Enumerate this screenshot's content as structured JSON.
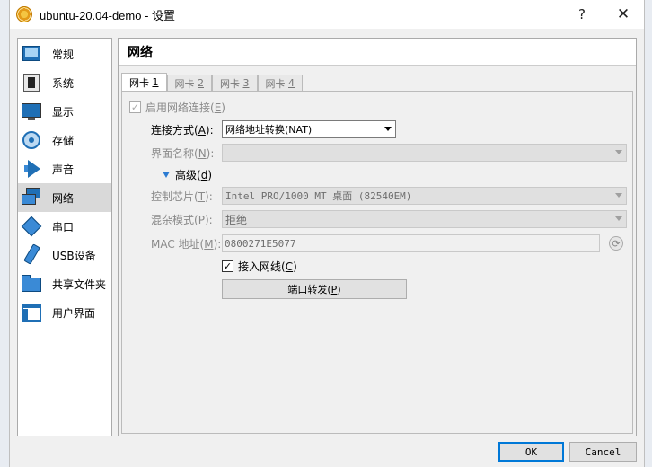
{
  "window": {
    "title": "ubuntu-20.04-demo - 设置",
    "help": "?",
    "close": "✕"
  },
  "sidebar": {
    "items": [
      {
        "label": "常规",
        "icon": "general-icon"
      },
      {
        "label": "系统",
        "icon": "system-icon"
      },
      {
        "label": "显示",
        "icon": "display-icon"
      },
      {
        "label": "存储",
        "icon": "storage-icon"
      },
      {
        "label": "声音",
        "icon": "audio-icon"
      },
      {
        "label": "网络",
        "icon": "network-icon",
        "selected": true
      },
      {
        "label": "串口",
        "icon": "serial-port-icon"
      },
      {
        "label": "USB设备",
        "icon": "usb-icon"
      },
      {
        "label": "共享文件夹",
        "icon": "shared-folder-icon"
      },
      {
        "label": "用户界面",
        "icon": "user-interface-icon"
      }
    ]
  },
  "page": {
    "title": "网络"
  },
  "tabs": [
    {
      "label": "网卡 ",
      "key": "1",
      "active": true
    },
    {
      "label": "网卡 ",
      "key": "2"
    },
    {
      "label": "网卡 ",
      "key": "3"
    },
    {
      "label": "网卡 ",
      "key": "4"
    }
  ],
  "form": {
    "enable_label": "启用网络连接(",
    "enable_key": "E",
    "enable_close": ")",
    "attached_label": "连接方式(",
    "attached_key": "A",
    "attached_close": "):",
    "attached_value": "网络地址转换(NAT)",
    "name_label": "界面名称(",
    "name_key": "N",
    "name_close": "):",
    "name_value": "",
    "advanced_label": "高级(",
    "advanced_key": "d",
    "advanced_close": ")",
    "adapter_label": "控制芯片(",
    "adapter_key": "T",
    "adapter_close": "):",
    "adapter_value": "Intel PRO/1000 MT 桌面 (82540EM)",
    "promisc_label": "混杂模式(",
    "promisc_key": "P",
    "promisc_close": "):",
    "promisc_value": "拒绝",
    "mac_label": "MAC 地址(",
    "mac_key": "M",
    "mac_close": "):",
    "mac_value": "0800271E5077",
    "cable_label": "接入网线(",
    "cable_key": "C",
    "cable_close": ")",
    "cable_checked": true,
    "portfwd_label": "端口转发(",
    "portfwd_key": "P",
    "portfwd_close": ")"
  },
  "footer": {
    "ok": "OK",
    "cancel": "Cancel"
  },
  "colors": {
    "accent": "#0078d7",
    "selected_bg": "#d9d9d9",
    "disabled_text": "#8a8a8a"
  }
}
